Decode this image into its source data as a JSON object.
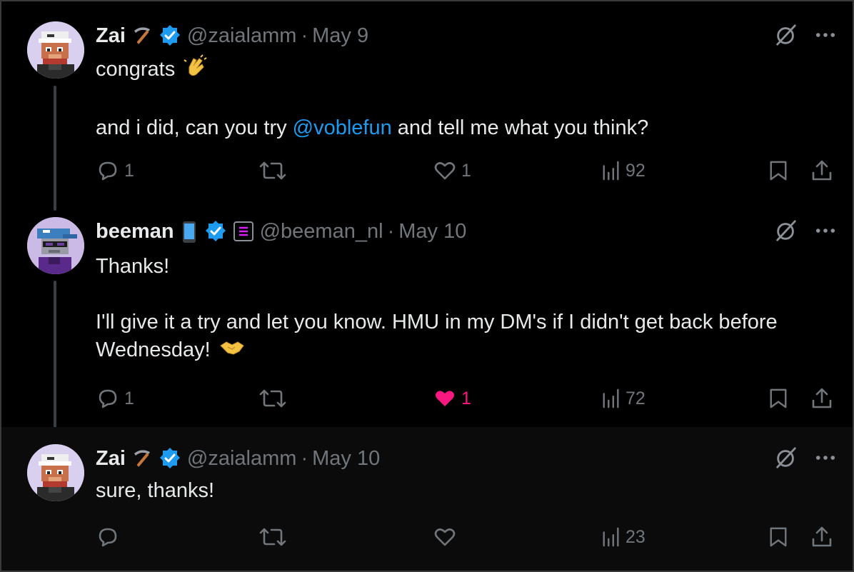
{
  "thread": [
    {
      "name": "Zai",
      "name_emoji": "pickaxe-icon",
      "handle": "@zaialamm",
      "separator": "·",
      "date": "May 9",
      "paragraphs": [
        {
          "text": "congrats",
          "emoji": "clapping-hands-icon"
        },
        {
          "before": "and i did, can you try ",
          "mention": "@voblefun",
          "after": " and tell me what you think?"
        }
      ],
      "stats": {
        "replies": "1",
        "reposts": "",
        "likes": "1",
        "views": "92"
      },
      "liked": false
    },
    {
      "name": "beeman",
      "name_emoji": "mobile-phone-icon",
      "handle": "@beeman_nl",
      "separator": "·",
      "date": "May 10",
      "paragraphs": [
        {
          "text": "Thanks!"
        },
        {
          "text": "I'll give it a try and let you know. HMU in my DM's if I didn't get back before Wednesday!",
          "emoji": "handshake-icon"
        }
      ],
      "stats": {
        "replies": "1",
        "reposts": "",
        "likes": "1",
        "views": "72"
      },
      "liked": true
    },
    {
      "name": "Zai",
      "name_emoji": "pickaxe-icon",
      "handle": "@zaialamm",
      "separator": "·",
      "date": "May 10",
      "paragraphs": [
        {
          "text": "sure, thanks!"
        }
      ],
      "stats": {
        "replies": "",
        "reposts": "",
        "likes": "",
        "views": "23"
      },
      "liked": false
    }
  ],
  "colors": {
    "background": "#000000",
    "text": "#e7e9ea",
    "muted": "#71767b",
    "link": "#1d9bf0",
    "like": "#f91880",
    "verified": "#1d9bf0"
  }
}
